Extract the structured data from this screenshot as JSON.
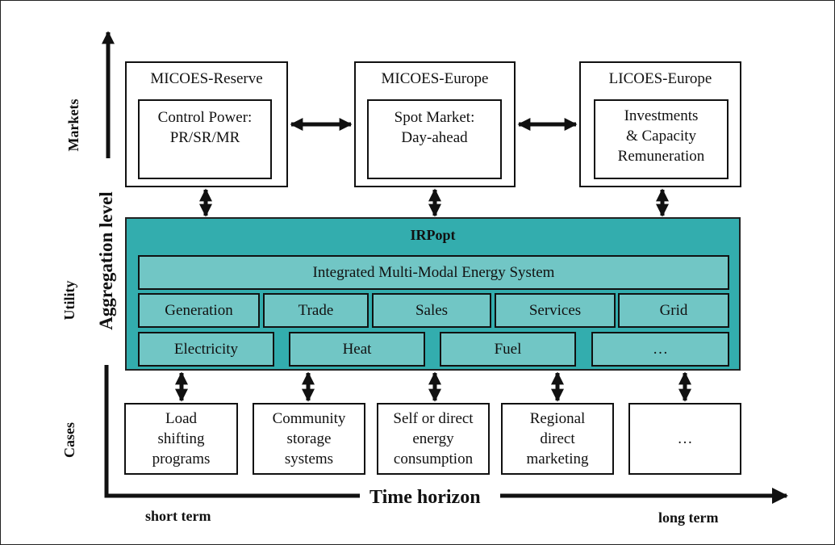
{
  "axes": {
    "vertical_title": "Aggregation level",
    "horizontal_title": "Time horizon",
    "levels": [
      "Markets",
      "Utility",
      "Cases"
    ],
    "short_term": "short term",
    "long_term": "long term"
  },
  "markets": [
    {
      "title": "MICOES-Reserve",
      "inner": [
        "Control Power:",
        "PR/SR/MR"
      ]
    },
    {
      "title": "MICOES-Europe",
      "inner": [
        "Spot Market:",
        "Day-ahead"
      ]
    },
    {
      "title": "LICOES-Europe",
      "inner": [
        "Investments",
        "& Capacity",
        "Remuneration"
      ]
    }
  ],
  "utility": {
    "title": "IRPopt",
    "system": "Integrated Multi-Modal Energy System",
    "functions": [
      "Generation",
      "Trade",
      "Sales",
      "Services",
      "Grid"
    ],
    "carriers": [
      "Electricity",
      "Heat",
      "Fuel",
      "…"
    ]
  },
  "cases": [
    [
      "Load",
      "shifting",
      "programs"
    ],
    [
      "Community",
      "storage",
      "systems"
    ],
    [
      "Self or direct",
      "energy",
      "consumption"
    ],
    [
      "Regional",
      "direct",
      "marketing"
    ],
    [
      "…"
    ]
  ],
  "colors": {
    "utility_bg": "#33adae",
    "utility_cell": "#71c6c5",
    "line": "#111111"
  }
}
